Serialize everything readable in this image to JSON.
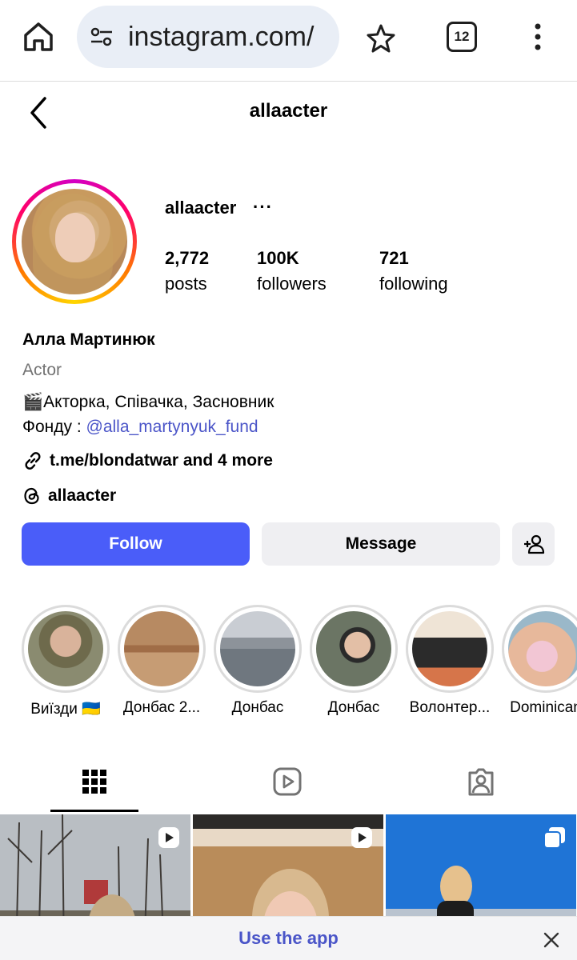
{
  "browser": {
    "url": "instagram.com/",
    "tab_count": "12",
    "icons": [
      "home-icon",
      "site-settings-icon",
      "star-icon",
      "tabs-icon",
      "more-vert-icon"
    ]
  },
  "header": {
    "title": "allaacter"
  },
  "profile": {
    "username": "allaacter",
    "more": "···",
    "stats": [
      {
        "num": "2,772",
        "label": "posts"
      },
      {
        "num": "100K",
        "label": "followers"
      },
      {
        "num": "721",
        "label": "following"
      }
    ],
    "full_name": "Алла Мартинюк",
    "category": "Actor",
    "bio_line1": "🎬Акторка, Співачка, Засновник",
    "bio_line2_prefix": "Фонду : ",
    "bio_mention": "@alla_martynyuk_fund",
    "link_text": "t.me/blondatwar and 4 more",
    "threads_handle": "allaacter"
  },
  "actions": {
    "follow": "Follow",
    "message": "Message"
  },
  "highlights": [
    {
      "label": "Виїзди 🇺🇦"
    },
    {
      "label": "Донбас 2..."
    },
    {
      "label": "Донбас"
    },
    {
      "label": "Донбас"
    },
    {
      "label": "Волонтер..."
    },
    {
      "label": "Dominican"
    }
  ],
  "tabs": [
    "grid-icon",
    "reels-icon",
    "tagged-icon"
  ],
  "footer": {
    "use_app": "Use the app"
  },
  "colors": {
    "follow_button": "#4a5df9",
    "mention": "#4b55c8",
    "secondary_text": "#737373"
  }
}
